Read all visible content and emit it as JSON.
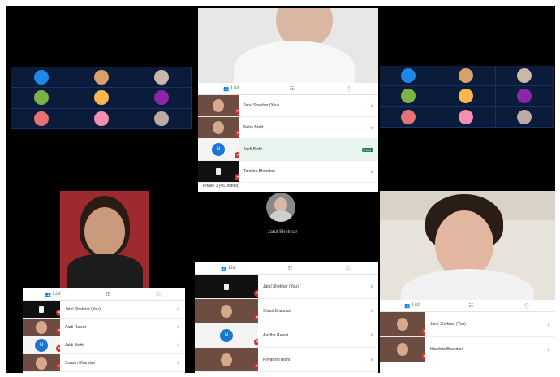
{
  "palette": {
    "canvas": "#000000",
    "grid_bg": "#0b1b3a",
    "accent": "#2e7d4f",
    "badge": "#d32f2f",
    "avatar_blue": "#1976d2"
  },
  "top_center": {
    "tabs": [
      {
        "label": "List",
        "icon": "people-icon"
      },
      {
        "label": "",
        "icon": "chat-icon"
      },
      {
        "label": "",
        "icon": "info-icon"
      }
    ],
    "rows": [
      {
        "name": "Jatul Shekhar (You)",
        "thumb": "photo"
      },
      {
        "name": "Neha Bisht",
        "thumb": "photo"
      },
      {
        "name": "Jaldi Bisht",
        "thumb": "initial",
        "initial": "N",
        "highlight": "true",
        "tag": "Host"
      },
      {
        "name": "Tanisha Bhandari",
        "thumb": "dark"
      }
    ],
    "footer": "Phase 1 (46 Joined)"
  },
  "center_caller": {
    "name": "Jatul Shekhar"
  },
  "bottom_left": {
    "tabs": [
      {
        "label": "List",
        "icon": "people-icon"
      },
      {
        "label": "",
        "icon": "chat-icon"
      },
      {
        "label": "",
        "icon": "info-icon"
      }
    ],
    "rows": [
      {
        "name": "Jatul Shekhar (You)",
        "thumb": "dark"
      },
      {
        "name": "Aarti Rawat",
        "thumb": "photo"
      },
      {
        "name": "Jaldi Bisht",
        "thumb": "initial",
        "initial": "N"
      },
      {
        "name": "Sonam Bhandari",
        "thumb": "photo"
      }
    ]
  },
  "bottom_center": {
    "tabs": [
      {
        "label": "List",
        "icon": "people-icon"
      },
      {
        "label": "",
        "icon": "chat-icon"
      },
      {
        "label": "",
        "icon": "info-icon"
      }
    ],
    "rows": [
      {
        "name": "Jatul Shekhar (You)",
        "thumb": "dark"
      },
      {
        "name": "Shruti Bhandari",
        "thumb": "photo"
      },
      {
        "name": "Aastha Rawat",
        "thumb": "initial",
        "initial": "N"
      },
      {
        "name": "Priyanshi Bisht",
        "thumb": "photo"
      }
    ]
  },
  "bottom_right": {
    "tabs": [
      {
        "label": "List",
        "icon": "people-icon"
      },
      {
        "label": "",
        "icon": "chat-icon"
      },
      {
        "label": "",
        "icon": "info-icon"
      }
    ],
    "rows": [
      {
        "name": "Jatul Shekhar (You)",
        "thumb": "photo"
      },
      {
        "name": "Harshita Bhandari",
        "thumb": "photo"
      }
    ]
  },
  "left_grid": {
    "tiles": [
      {
        "color": "#1e88e5",
        "label": ""
      },
      {
        "color": "#d8a06a",
        "label": ""
      },
      {
        "color": "#c9b8a8",
        "label": ""
      },
      {
        "color": "#7cb342",
        "label": ""
      },
      {
        "color": "#ffb74d",
        "label": ""
      },
      {
        "color": "#8e24aa",
        "label": ""
      },
      {
        "color": "#e57373",
        "label": ""
      },
      {
        "color": "#f48fb1",
        "label": ""
      },
      {
        "color": "#bcaaa4",
        "label": ""
      }
    ]
  },
  "right_grid": {
    "tiles": [
      {
        "color": "#1e88e5",
        "label": ""
      },
      {
        "color": "#d8a06a",
        "label": ""
      },
      {
        "color": "#c9b8a8",
        "label": ""
      },
      {
        "color": "#7cb342",
        "label": ""
      },
      {
        "color": "#ffb74d",
        "label": ""
      },
      {
        "color": "#8e24aa",
        "label": ""
      },
      {
        "color": "#e57373",
        "label": ""
      },
      {
        "color": "#f48fb1",
        "label": ""
      },
      {
        "color": "#bcaaa4",
        "label": ""
      }
    ]
  }
}
